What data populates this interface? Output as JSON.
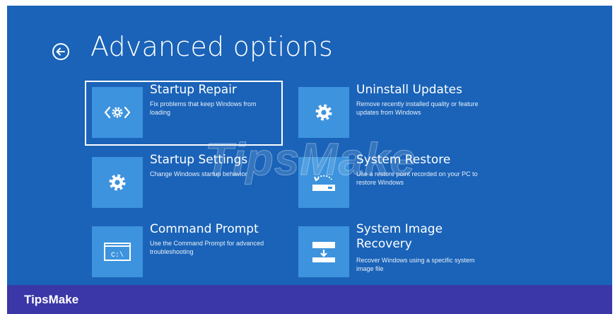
{
  "screen": {
    "title": "Advanced options",
    "bg_color": "#1a63b8",
    "tile_color": "#3d93dd"
  },
  "options": [
    {
      "title": "Startup Repair",
      "description": "Fix problems that keep Windows from loading",
      "icon": "startup-repair-icon",
      "selected": true
    },
    {
      "title": "Uninstall Updates",
      "description": "Remove recently installed quality or feature updates from Windows",
      "icon": "gear-icon"
    },
    {
      "title": "Startup Settings",
      "description": "Change Windows startup behavior",
      "icon": "gear-icon"
    },
    {
      "title": "System Restore",
      "description": "Use a restore point recorded on your PC to restore Windows",
      "icon": "system-restore-icon"
    },
    {
      "title": "Command Prompt",
      "description": "Use the Command Prompt for advanced troubleshooting",
      "icon": "command-prompt-icon",
      "icon_text": "C:\\"
    },
    {
      "title": "System Image Recovery",
      "description": "Recover Windows using a specific system image file",
      "icon": "system-image-icon"
    }
  ],
  "watermark": "TipsMake",
  "footer": {
    "brand": "TipsMake",
    "bar_color": "#3b37a8"
  }
}
